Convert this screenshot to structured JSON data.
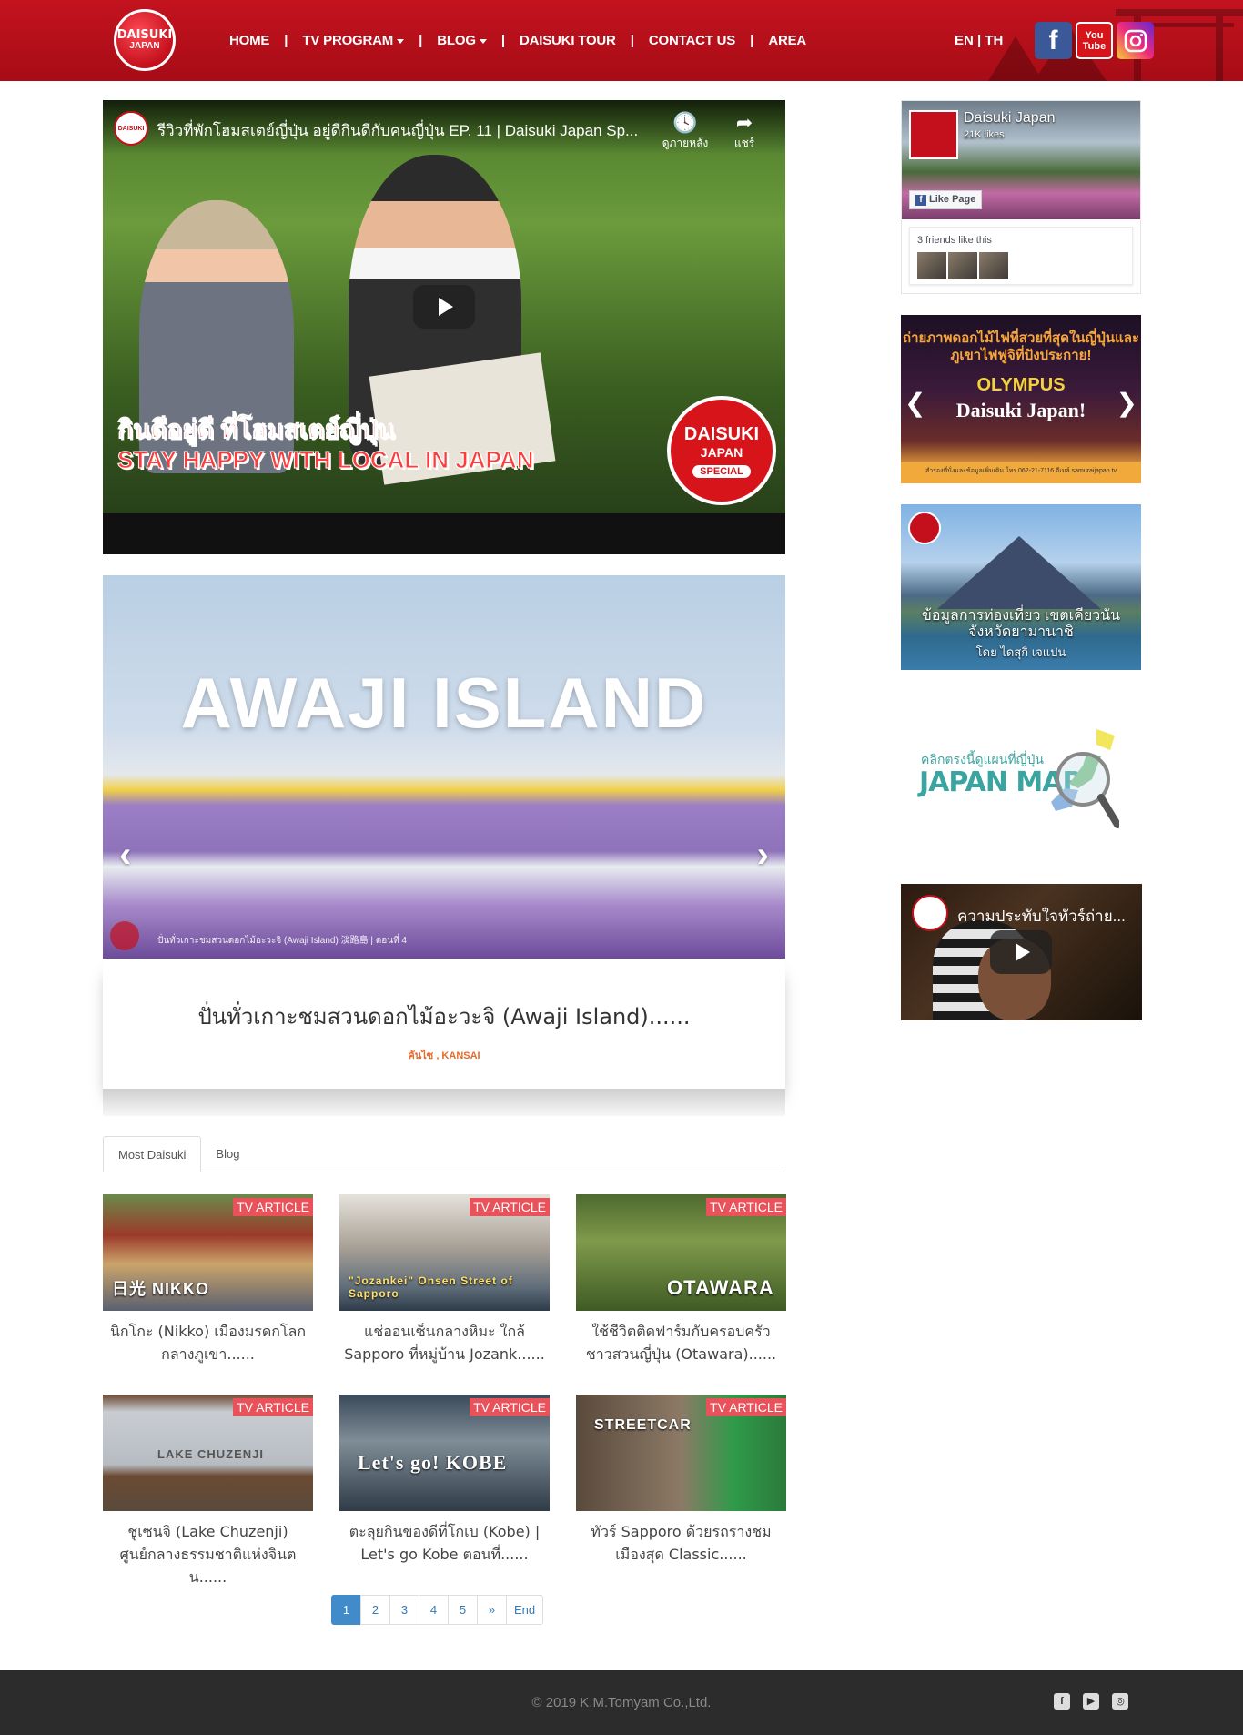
{
  "brand": {
    "logo_line1": "DAISUKI",
    "logo_line2": "JAPAN",
    "accent": "#c3131f"
  },
  "nav": {
    "items": [
      {
        "label": "HOME"
      },
      {
        "label": "TV PROGRAM"
      },
      {
        "label": "BLOG"
      },
      {
        "label": "DAISUKI TOUR"
      },
      {
        "label": "CONTACT US"
      },
      {
        "label": "AREA"
      }
    ],
    "separator": "|",
    "lang_en": "EN",
    "lang_sep": " | ",
    "lang_th": "TH",
    "social": {
      "facebook": "f",
      "youtube_1": "You",
      "youtube_2": "Tube"
    }
  },
  "main_video": {
    "title": "รีวิวที่พักโฮมสเตย์ญี่ปุ่น อยู่ดีกินดีกับคนญี่ปุ่น EP. 11 | Daisuki Japan Sp...",
    "channel_badge": "DAISUKI",
    "watch_later": "ดูภายหลัง",
    "share": "แชร์",
    "caption_th": "กินดีอยู่ดี ที่โฮมสเตย์ญี่ปุ่น",
    "caption_en": "STAY HAPPY WITH LOCAL IN JAPAN",
    "badge_1": "DAISUKI",
    "badge_2": "JAPAN",
    "badge_3": "SPECIAL"
  },
  "carousel": {
    "title": "AWAJI ISLAND",
    "subtitle": "ปั่นทั่วเกาะชมสวนดอกไม้อะวะจิ (Awaji Island) 淡路島 | ตอนที่ 4",
    "prev": "‹",
    "next": "›"
  },
  "feature": {
    "title": "ปั่นทั่วเกาะชมสวนดอกไม้อะวะจิ (Awaji Island)......",
    "tags": "คันไซ , KANSAI"
  },
  "tabs": [
    {
      "label": "Most Daisuki"
    },
    {
      "label": "Blog"
    }
  ],
  "articles": [
    {
      "badge": "TV ARTICLE",
      "overlay": "日光 NIKKO",
      "title": "นิกโกะ (Nikko) เมืองมรดกโลกกลางภูเขา......"
    },
    {
      "badge": "TV ARTICLE",
      "overlay": "\"Jozankei\" Onsen Street of Sapporo",
      "title": "แช่ออนเซ็นกลางหิมะ ใกล้ Sapporo ที่หมู่บ้าน Jozank......"
    },
    {
      "badge": "TV ARTICLE",
      "overlay": "OTAWARA",
      "title": "ใช้ชีวิตติดฟาร์มกับครอบครัวชาวสวนญี่ปุ่น (Otawara)......"
    },
    {
      "badge": "TV ARTICLE",
      "overlay": "LAKE CHUZENJI",
      "title": "ชูเซนจิ (Lake Chuzenji) ศูนย์กลางธรรมชาติแห่งจินตน......"
    },
    {
      "badge": "TV ARTICLE",
      "overlay": "Let's go! KOBE",
      "title": "ตะลุยกินของดีที่โกเบ (Kobe) | Let's go Kobe ตอนที่......"
    },
    {
      "badge": "TV ARTICLE",
      "overlay": "STREETCAR",
      "title": "ทัวร์ Sapporo ด้วยรถรางชมเมืองสุด Classic......"
    }
  ],
  "pagination": [
    "1",
    "2",
    "3",
    "4",
    "5",
    "»",
    "End"
  ],
  "sidebar": {
    "fb": {
      "page_name": "Daisuki Japan",
      "likes": "21K likes",
      "like_button": "Like Page",
      "friends_text": "3 friends like this"
    },
    "banner1": {
      "line1": "ถ่ายภาพดอกไม้ไฟที่สวยที่สุดในญี่ปุ่นและภูเขาไฟฟูจิที่ปังประกาย!",
      "line2": "OLYMPUS",
      "line3": "Daisuki Japan!",
      "line4": "สำรองที่นั่งและข้อมูลเพิ่มเติม โทร 062-21-7116 อีเมล์ samuraijapan.tv"
    },
    "banner2": {
      "line1": "ข้อมูลการท่องเที่ยว เขตเคียวนัน จังหวัดยามานาชิ",
      "line2": "โดย ไดสุกิ เจแปน"
    },
    "banner3": {
      "line1": "คลิกตรงนี้ดูแผนที่ญี่ปุ่น",
      "line2": "JAPAN MAP"
    },
    "side_video": {
      "title": "ความประทับใจทัวร์ถ่าย..."
    }
  },
  "footer": {
    "copyright": "© 2019 K.M.Tomyam Co.,Ltd.",
    "social": {
      "facebook": "f",
      "youtube": "▶",
      "instagram": "◎"
    }
  }
}
